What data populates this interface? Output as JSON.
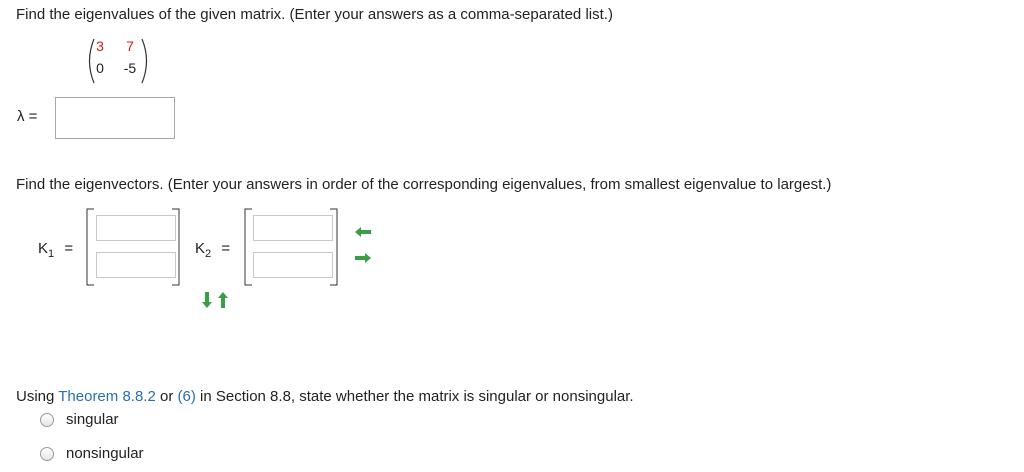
{
  "q1": {
    "text": "Find the eigenvalues of the given matrix. (Enter your answers as a comma-separated list.)",
    "matrix": [
      [
        "3",
        "7"
      ],
      [
        "0",
        "-5"
      ]
    ],
    "lambda_label": "λ =",
    "answer_value": ""
  },
  "q2": {
    "text": "Find the eigenvectors. (Enter your answers in order of the corresponding eigenvalues, from smallest eigenvalue to largest.)",
    "k1_label": "K",
    "k1_sub": "1",
    "k2_label": "K",
    "k2_sub": "2",
    "eq": "=",
    "colors": {
      "arrow_green": "#3a9d48"
    }
  },
  "q3": {
    "prefix": "Using ",
    "link1": "Theorem 8.8.2",
    "mid1": " or ",
    "link2": "(6)",
    "suffix": " in Section 8.8, state whether the matrix is singular or nonsingular.",
    "options": [
      "singular",
      "nonsingular"
    ],
    "colors": {
      "link": "#2a6db5",
      "matrix_entry": "#cc1f1f"
    }
  },
  "icons": [
    "left-arrow-icon",
    "right-arrow-icon",
    "down-arrow-icon",
    "up-arrow-icon",
    "radio-icon"
  ]
}
